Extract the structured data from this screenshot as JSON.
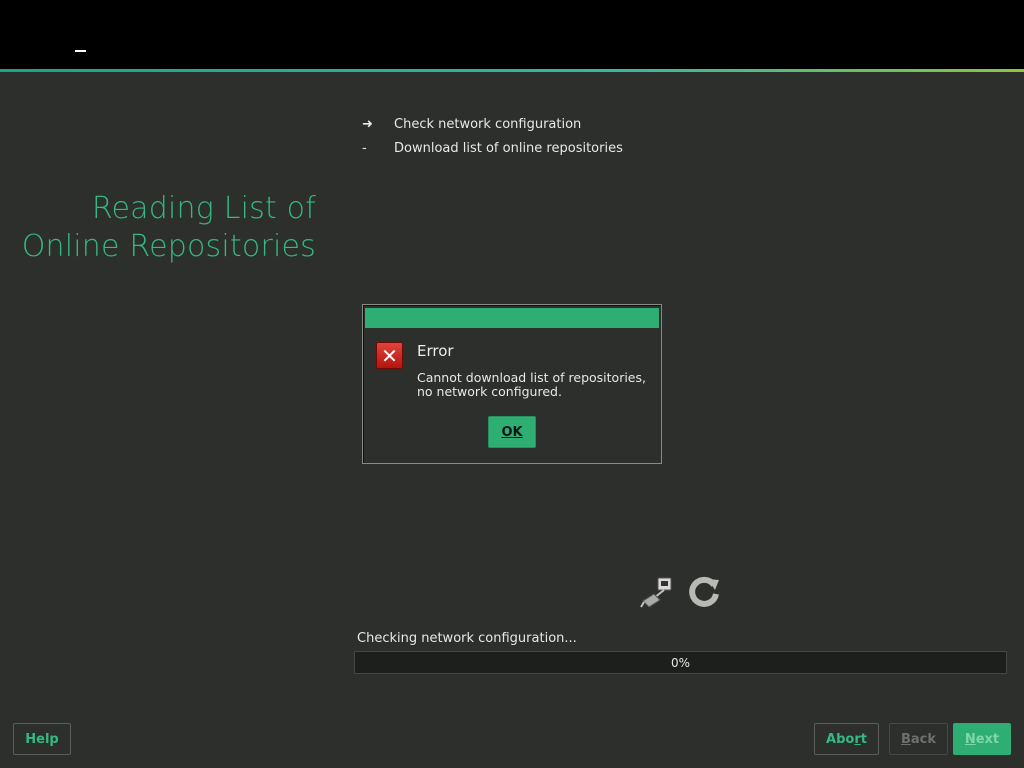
{
  "header": {
    "logo_icon": "logo-mark"
  },
  "page": {
    "title": "Reading List of\nOnline Repositories"
  },
  "steps": [
    {
      "mark": "➜",
      "label": "Check network configuration",
      "state": "current"
    },
    {
      "mark": "-",
      "label": "Download list of online repositories",
      "state": "pending"
    }
  ],
  "dialog": {
    "icon": "error-icon",
    "heading": "Error",
    "message": "Cannot download list of repositories,\nno network configured.",
    "ok_label": "OK"
  },
  "status": {
    "icons": [
      "network-icon",
      "refresh-icon"
    ],
    "text": "Checking network configuration...",
    "progress_label": "0%",
    "progress_value": 0
  },
  "buttons": {
    "help": "Help",
    "abort": "Abort",
    "back": "Back",
    "next": "Next"
  },
  "colors": {
    "accent": "#35b982",
    "button_fill": "#2fae74",
    "background": "#2d2f2c",
    "error": "#c9221b"
  }
}
